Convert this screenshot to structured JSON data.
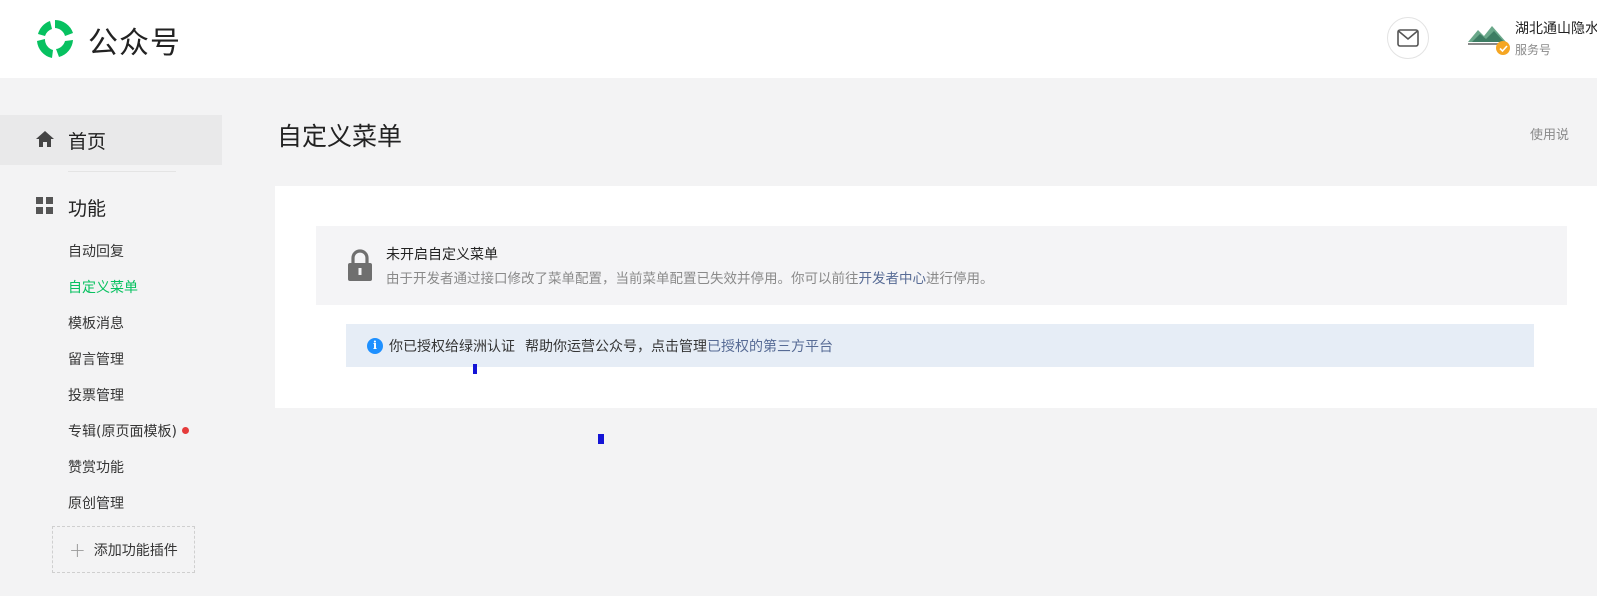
{
  "header": {
    "brand": "公众号",
    "account_name": "湖北通山隐水",
    "account_type": "服务号"
  },
  "sidebar": {
    "home_label": "首页",
    "function_label": "功能",
    "items": [
      {
        "label": "自动回复"
      },
      {
        "label": "自定义菜单",
        "active": true
      },
      {
        "label": "模板消息"
      },
      {
        "label": "留言管理"
      },
      {
        "label": "投票管理"
      },
      {
        "label": "专辑(原页面模板)",
        "has_dot": true
      },
      {
        "label": "赞赏功能"
      },
      {
        "label": "原创管理"
      }
    ],
    "add_plugin_label": "添加功能插件"
  },
  "main": {
    "title": "自定义菜单",
    "help_link": "使用说",
    "notice": {
      "title": "未开启自定义菜单",
      "desc_prefix": "由于开发者通过接口修改了菜单配置，当前菜单配置已失效并停用。你可以前往",
      "desc_link": "开发者中心",
      "desc_suffix": "进行停用。"
    },
    "auth_bar": {
      "text_a": "你已授权给绿洲认证",
      "text_b": "帮助你运营公众号，点击管理",
      "link": "已授权的第三方平台"
    }
  },
  "colors": {
    "accent_green": "#07c160",
    "link_blue": "#576b95",
    "info_blue": "#1e90ff",
    "dot_red": "#e53b3b"
  }
}
